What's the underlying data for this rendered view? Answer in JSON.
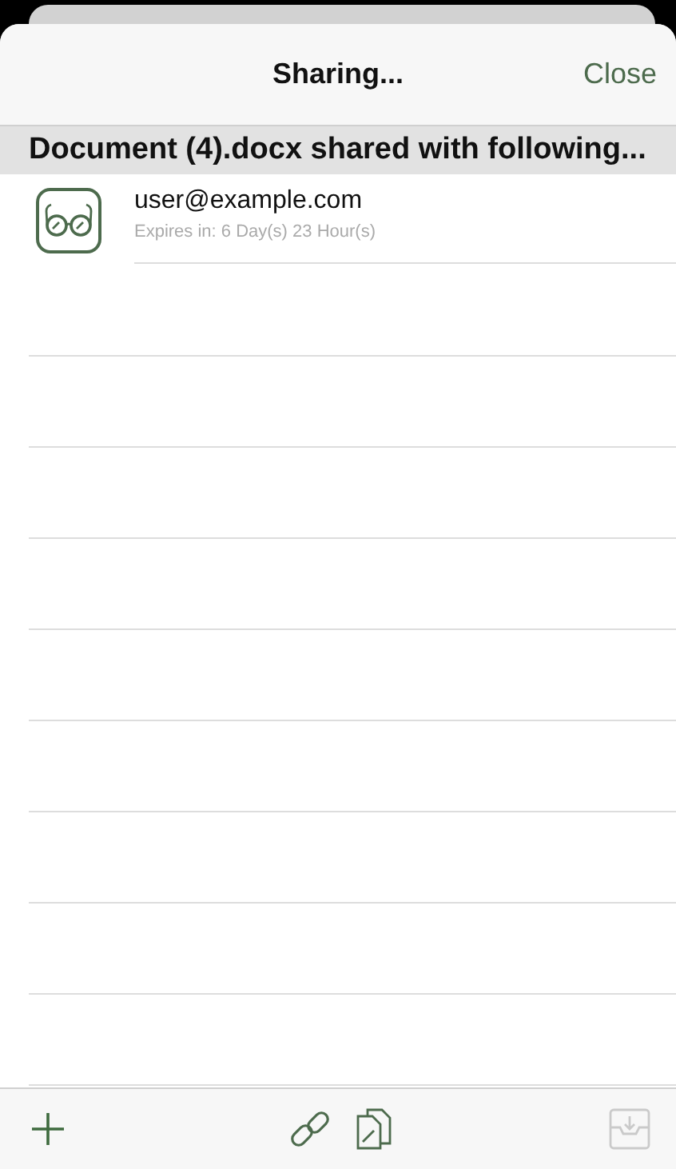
{
  "navigation_bar": {
    "title": "Sharing...",
    "close_button": "Close"
  },
  "section_header": "Document (4).docx shared with following...",
  "shares": [
    {
      "email": "user@example.com",
      "expiry": "Expires in: 6 Day(s) 23 Hour(s)",
      "kind": "viewer"
    }
  ],
  "toolbar": [
    {
      "kind": "add",
      "disabled": false
    },
    {
      "kind": "link",
      "disabled": false
    },
    {
      "kind": "copy-link",
      "disabled": false
    },
    {
      "kind": "export",
      "disabled": true
    }
  ]
}
